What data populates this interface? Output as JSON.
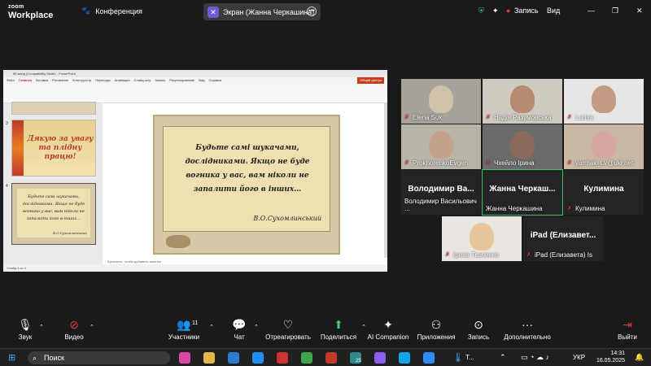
{
  "app": {
    "logo_line1": "zoom",
    "logo_line2": "Workplace",
    "meeting_label": "Конференция",
    "screen_share_label": "Экран (Жанна Черкашина)",
    "record_label": "Запись",
    "view_label": "Вид"
  },
  "ppt": {
    "title": "65 мэнд (Compatibility Mode) - PowerPoint",
    "search_placeholder": "Поиск",
    "menu": [
      "Файл",
      "Главная",
      "Вставка",
      "Рисование",
      "Конструктор",
      "Переходы",
      "Анимация",
      "Слайд-шоу",
      "Запись",
      "Рецензирование",
      "Вид",
      "Справка"
    ],
    "share_button": "Общий доступ",
    "notes_placeholder": "Щелкните, чтобы добавить заметки",
    "status": "Слайд 4 из 4",
    "thumb_text": "Дякую за увагу та плідну працю!",
    "thumb_numbers": [
      "3",
      "4"
    ]
  },
  "slide": {
    "quote": "Будьте самі шукачами, дослідниками. Якщо не буде вогника у вас, вам ніколи не запалити його в інших…",
    "author": "В.О.Сухомлинський"
  },
  "participants": [
    {
      "name": "Elena Suk"
    },
    {
      "name": "Надія Разумовська"
    },
    {
      "name": "Larisa"
    },
    {
      "name": "ProkhorenkoEvgen"
    },
    {
      "name": "Чхейло Ірина"
    },
    {
      "name": "yarmak_t.v@ukr.net"
    },
    {
      "name": "Володимир Васильович ...",
      "big": "Володимир Ва..."
    },
    {
      "name": "Жанна Черкашина",
      "big": "Жанна Черкаш..."
    },
    {
      "name": "Кулимина",
      "big": "Кулимина"
    },
    {
      "name": "Ірина Ткаченко"
    },
    {
      "name": "iPad (Елизавета) Is",
      "big": "iPad (Елизавет..."
    }
  ],
  "toolbar": {
    "audio": "Звук",
    "video": "Видео",
    "participants": "Участники",
    "participants_count": "11",
    "chat": "Чат",
    "react": "Отреагировать",
    "share": "Поделиться",
    "ai": "AI Companion",
    "apps": "Приложения",
    "record": "Запись",
    "more": "Дополнительно",
    "leave": "Выйти"
  },
  "taskbar": {
    "search": "Поиск",
    "weather": "Т...",
    "lang": "УКР",
    "time": "14:31",
    "date": "16.05.2025",
    "badge_25": "25"
  },
  "colors": {
    "accent": "#3ec46d",
    "mic_off": "#e23b3b",
    "record": "#e23b3b"
  }
}
